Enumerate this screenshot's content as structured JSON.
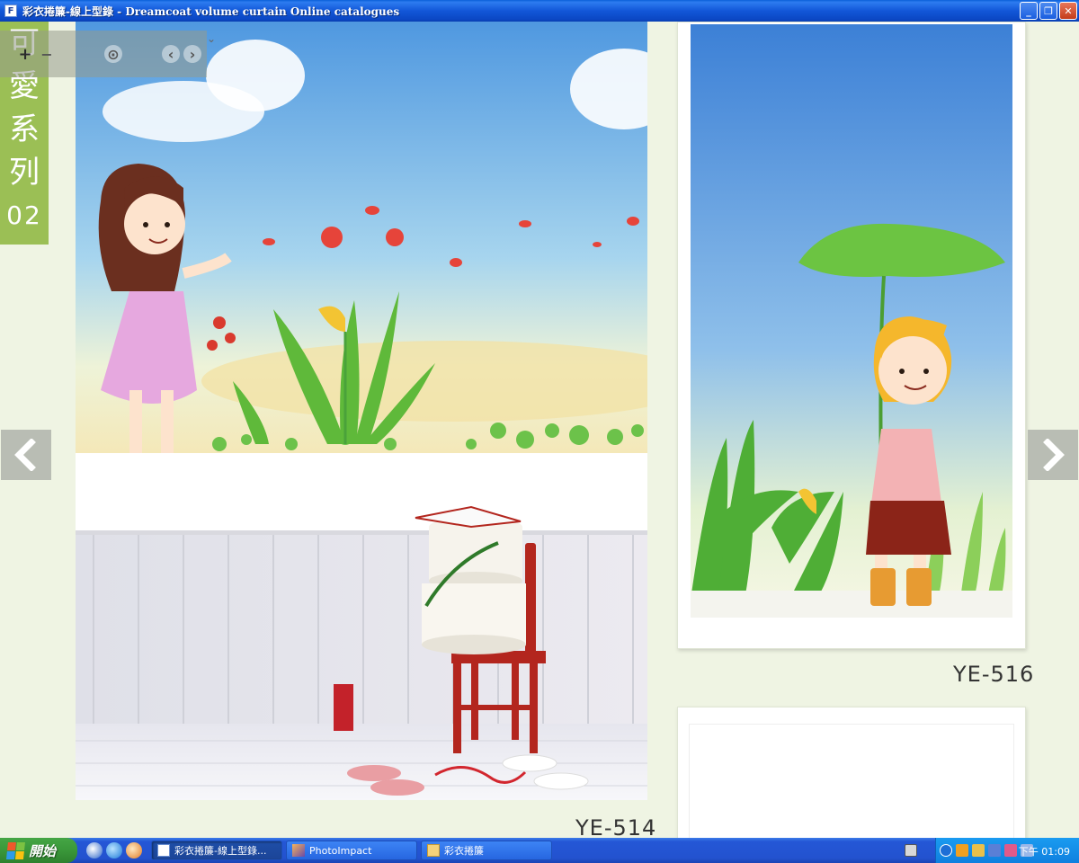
{
  "window": {
    "app_icon_letter": "F",
    "title": "彩衣捲簾-線上型錄 - Dreamcoat volume curtain Online catalogues",
    "buttons": {
      "minimize": "_",
      "restore": "❐",
      "close": "✕"
    }
  },
  "viewer": {
    "series_label_chars": [
      "可",
      "愛",
      "系",
      "列"
    ],
    "series_number": "02",
    "toolbar": {
      "zoom_in": "+",
      "zoom_out": "−",
      "zoom_fit": "⊙",
      "prev": "‹",
      "next": "›",
      "menu": "⌄"
    },
    "products": [
      {
        "code": "YE-514"
      },
      {
        "code": "YE-516"
      }
    ]
  },
  "taskbar": {
    "start_label": "開始",
    "tasks": [
      {
        "label": "彩衣捲簾-線上型錄...",
        "active": true
      },
      {
        "label": "PhotoImpact",
        "active": false
      },
      {
        "label": "彩衣捲簾",
        "active": false
      }
    ],
    "clock": "下午 01:09"
  },
  "colors": {
    "series_green": "#9bbf55",
    "page_bg": "#eff4e3",
    "titlebar_blue": "#1257d8"
  }
}
